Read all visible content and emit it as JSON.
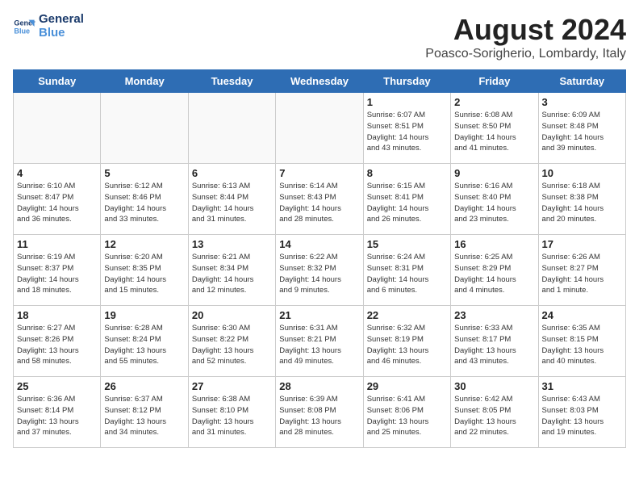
{
  "header": {
    "logo_line1": "General",
    "logo_line2": "Blue",
    "month_title": "August 2024",
    "location": "Poasco-Sorigherio, Lombardy, Italy"
  },
  "weekdays": [
    "Sunday",
    "Monday",
    "Tuesday",
    "Wednesday",
    "Thursday",
    "Friday",
    "Saturday"
  ],
  "weeks": [
    [
      {
        "day": "",
        "info": ""
      },
      {
        "day": "",
        "info": ""
      },
      {
        "day": "",
        "info": ""
      },
      {
        "day": "",
        "info": ""
      },
      {
        "day": "1",
        "info": "Sunrise: 6:07 AM\nSunset: 8:51 PM\nDaylight: 14 hours\nand 43 minutes."
      },
      {
        "day": "2",
        "info": "Sunrise: 6:08 AM\nSunset: 8:50 PM\nDaylight: 14 hours\nand 41 minutes."
      },
      {
        "day": "3",
        "info": "Sunrise: 6:09 AM\nSunset: 8:48 PM\nDaylight: 14 hours\nand 39 minutes."
      }
    ],
    [
      {
        "day": "4",
        "info": "Sunrise: 6:10 AM\nSunset: 8:47 PM\nDaylight: 14 hours\nand 36 minutes."
      },
      {
        "day": "5",
        "info": "Sunrise: 6:12 AM\nSunset: 8:46 PM\nDaylight: 14 hours\nand 33 minutes."
      },
      {
        "day": "6",
        "info": "Sunrise: 6:13 AM\nSunset: 8:44 PM\nDaylight: 14 hours\nand 31 minutes."
      },
      {
        "day": "7",
        "info": "Sunrise: 6:14 AM\nSunset: 8:43 PM\nDaylight: 14 hours\nand 28 minutes."
      },
      {
        "day": "8",
        "info": "Sunrise: 6:15 AM\nSunset: 8:41 PM\nDaylight: 14 hours\nand 26 minutes."
      },
      {
        "day": "9",
        "info": "Sunrise: 6:16 AM\nSunset: 8:40 PM\nDaylight: 14 hours\nand 23 minutes."
      },
      {
        "day": "10",
        "info": "Sunrise: 6:18 AM\nSunset: 8:38 PM\nDaylight: 14 hours\nand 20 minutes."
      }
    ],
    [
      {
        "day": "11",
        "info": "Sunrise: 6:19 AM\nSunset: 8:37 PM\nDaylight: 14 hours\nand 18 minutes."
      },
      {
        "day": "12",
        "info": "Sunrise: 6:20 AM\nSunset: 8:35 PM\nDaylight: 14 hours\nand 15 minutes."
      },
      {
        "day": "13",
        "info": "Sunrise: 6:21 AM\nSunset: 8:34 PM\nDaylight: 14 hours\nand 12 minutes."
      },
      {
        "day": "14",
        "info": "Sunrise: 6:22 AM\nSunset: 8:32 PM\nDaylight: 14 hours\nand 9 minutes."
      },
      {
        "day": "15",
        "info": "Sunrise: 6:24 AM\nSunset: 8:31 PM\nDaylight: 14 hours\nand 6 minutes."
      },
      {
        "day": "16",
        "info": "Sunrise: 6:25 AM\nSunset: 8:29 PM\nDaylight: 14 hours\nand 4 minutes."
      },
      {
        "day": "17",
        "info": "Sunrise: 6:26 AM\nSunset: 8:27 PM\nDaylight: 14 hours\nand 1 minute."
      }
    ],
    [
      {
        "day": "18",
        "info": "Sunrise: 6:27 AM\nSunset: 8:26 PM\nDaylight: 13 hours\nand 58 minutes."
      },
      {
        "day": "19",
        "info": "Sunrise: 6:28 AM\nSunset: 8:24 PM\nDaylight: 13 hours\nand 55 minutes."
      },
      {
        "day": "20",
        "info": "Sunrise: 6:30 AM\nSunset: 8:22 PM\nDaylight: 13 hours\nand 52 minutes."
      },
      {
        "day": "21",
        "info": "Sunrise: 6:31 AM\nSunset: 8:21 PM\nDaylight: 13 hours\nand 49 minutes."
      },
      {
        "day": "22",
        "info": "Sunrise: 6:32 AM\nSunset: 8:19 PM\nDaylight: 13 hours\nand 46 minutes."
      },
      {
        "day": "23",
        "info": "Sunrise: 6:33 AM\nSunset: 8:17 PM\nDaylight: 13 hours\nand 43 minutes."
      },
      {
        "day": "24",
        "info": "Sunrise: 6:35 AM\nSunset: 8:15 PM\nDaylight: 13 hours\nand 40 minutes."
      }
    ],
    [
      {
        "day": "25",
        "info": "Sunrise: 6:36 AM\nSunset: 8:14 PM\nDaylight: 13 hours\nand 37 minutes."
      },
      {
        "day": "26",
        "info": "Sunrise: 6:37 AM\nSunset: 8:12 PM\nDaylight: 13 hours\nand 34 minutes."
      },
      {
        "day": "27",
        "info": "Sunrise: 6:38 AM\nSunset: 8:10 PM\nDaylight: 13 hours\nand 31 minutes."
      },
      {
        "day": "28",
        "info": "Sunrise: 6:39 AM\nSunset: 8:08 PM\nDaylight: 13 hours\nand 28 minutes."
      },
      {
        "day": "29",
        "info": "Sunrise: 6:41 AM\nSunset: 8:06 PM\nDaylight: 13 hours\nand 25 minutes."
      },
      {
        "day": "30",
        "info": "Sunrise: 6:42 AM\nSunset: 8:05 PM\nDaylight: 13 hours\nand 22 minutes."
      },
      {
        "day": "31",
        "info": "Sunrise: 6:43 AM\nSunset: 8:03 PM\nDaylight: 13 hours\nand 19 minutes."
      }
    ]
  ]
}
